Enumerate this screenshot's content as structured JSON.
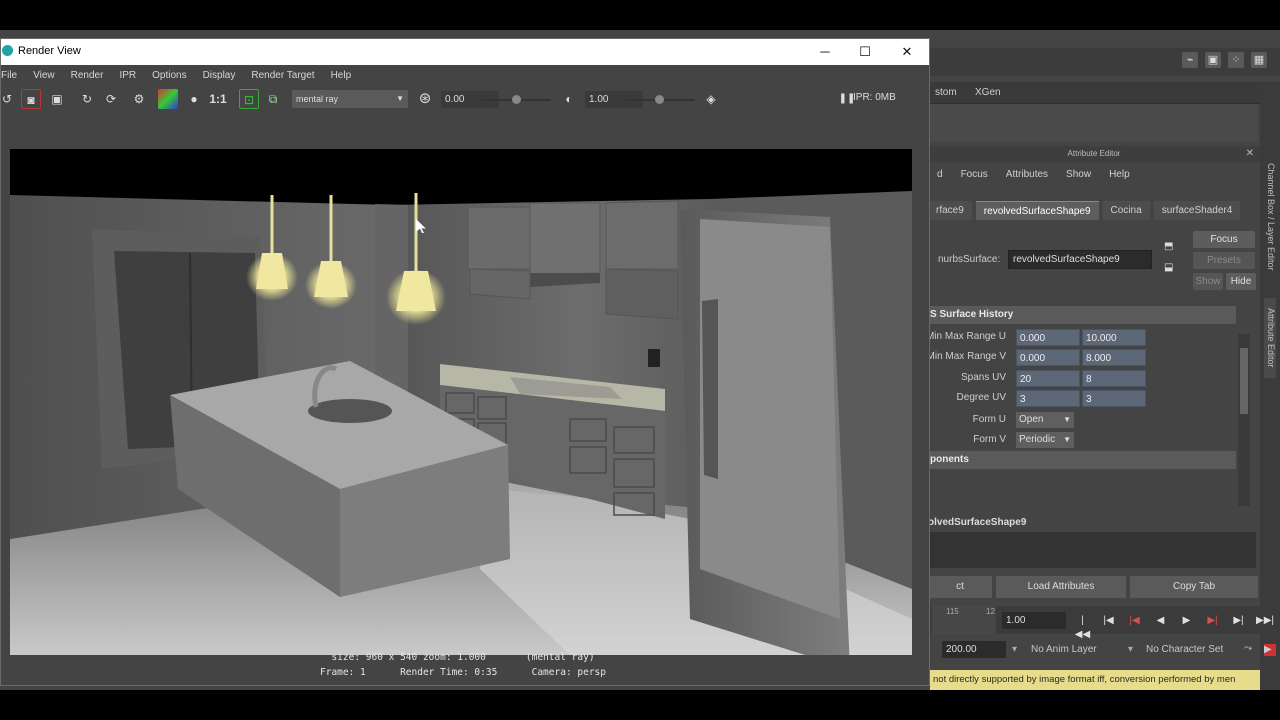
{
  "render_view": {
    "title": "Render View",
    "menu": [
      "File",
      "View",
      "Render",
      "IPR",
      "Options",
      "Display",
      "Render Target",
      "Help"
    ],
    "renderer": "mental ray",
    "exposure": "0.00",
    "gamma": "1.00",
    "ratio_label": "1:1",
    "ipr_status": "IPR: 0MB",
    "info_line1": "size: 960 x 540 zoom: 1.000       (mental ray)",
    "info_line2": "Frame: 1      Render Time: 0:35      Camera: persp",
    "window_buttons": {
      "minimize": "─",
      "maximize": "☐",
      "close": "✕"
    }
  },
  "maya": {
    "tabs": [
      "stom",
      "XGen"
    ],
    "attribute_editor": {
      "title": "Attribute Editor",
      "menu": [
        "d",
        "Focus",
        "Attributes",
        "Show",
        "Help"
      ],
      "node_tabs": [
        "rface9",
        "revolvedSurfaceShape9",
        "Cocina",
        "surfaceShader4"
      ],
      "active_tab": "revolvedSurfaceShape9",
      "nurbs_label": "nurbsSurface:",
      "nurbs_value": "revolvedSurfaceShape9",
      "focus_button": "Focus",
      "presets_button": "Presets",
      "show_button": "Show",
      "hide_button": "Hide",
      "section_history": "S Surface History",
      "rows": [
        {
          "label": "Min Max Range U",
          "v1": "0.000",
          "v2": "10.000"
        },
        {
          "label": "Min Max Range V",
          "v1": "0.000",
          "v2": "8.000"
        },
        {
          "label": "Spans UV",
          "v1": "20",
          "v2": "8"
        },
        {
          "label": "Degree UV",
          "v1": "3",
          "v2": "3"
        }
      ],
      "form_u_label": "Form U",
      "form_u_value": "Open",
      "form_v_label": "Form V",
      "form_v_value": "Periodic",
      "section_components": "ponents",
      "node_name_bar": "olvedSurfaceShape9",
      "buttons": [
        "ct",
        "Load Attributes",
        "Copy Tab"
      ]
    },
    "timeline": {
      "tick_a": "115",
      "tick_b": "12",
      "current_frame": "1.00",
      "range_end": "200.00",
      "anim_layer": "No Anim Layer",
      "character_set": "No Character Set"
    },
    "warning": "not directly supported by image format iff, conversion performed by men"
  }
}
